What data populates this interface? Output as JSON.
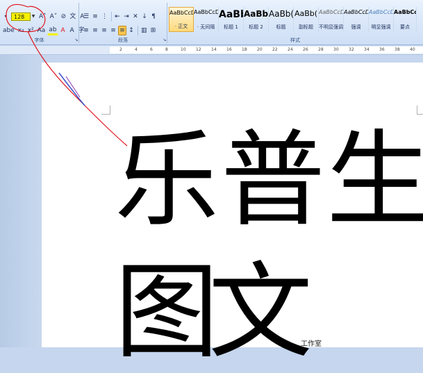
{
  "ribbon": {
    "font_size_value": "128",
    "groups": {
      "font": "字体",
      "paragraph": "段落",
      "styles": "样式"
    },
    "font_buttons_row1": [
      {
        "name": "grow-font-button",
        "glyph": "A˄"
      },
      {
        "name": "shrink-font-button",
        "glyph": "A˅"
      },
      {
        "name": "clear-format-button",
        "glyph": "⊘"
      },
      {
        "name": "phonetic-guide-button",
        "glyph": "文"
      },
      {
        "name": "char-border-button",
        "glyph": "A"
      }
    ],
    "font_buttons_row2": [
      {
        "name": "strikethrough-button",
        "glyph": "abe"
      },
      {
        "name": "subscript-button",
        "glyph": "x₂"
      },
      {
        "name": "superscript-button",
        "glyph": "x²"
      },
      {
        "name": "change-case-button",
        "glyph": "Aa"
      },
      {
        "name": "highlight-button",
        "glyph": "ab"
      },
      {
        "name": "font-color-button",
        "glyph": "A"
      },
      {
        "name": "char-shading-button",
        "glyph": "A"
      },
      {
        "name": "enclose-char-button",
        "glyph": "字"
      }
    ],
    "styles": [
      {
        "sample": "AaBbCcDd",
        "name": "· 正文",
        "size": "8px",
        "active": true,
        "width": 36
      },
      {
        "sample": "AaBbCcDd",
        "name": "· 无间隔",
        "size": "8px",
        "width": 36
      },
      {
        "sample": "AaBb",
        "name": "标题 1",
        "size": "14px",
        "bold": true,
        "width": 36
      },
      {
        "sample": "AaBb(",
        "name": "标题 2",
        "size": "12px",
        "bold": true,
        "width": 36
      },
      {
        "sample": "AaBb(",
        "name": "标题",
        "size": "12px",
        "width": 36
      },
      {
        "sample": "AaBb(",
        "name": "副标题",
        "size": "11px",
        "width": 36
      },
      {
        "sample": "AaBbCcDd",
        "name": "不明显强调",
        "size": "8px",
        "italic": true,
        "color": "#666",
        "width": 36
      },
      {
        "sample": "AaBbCcDd",
        "name": "强调",
        "size": "8px",
        "italic": true,
        "width": 36
      },
      {
        "sample": "AaBbCcDd",
        "name": "明显强调",
        "size": "8px",
        "italic": true,
        "color": "#4f81bd",
        "width": 36
      },
      {
        "sample": "AaBbCcDd",
        "name": "要点",
        "size": "8px",
        "bold": true,
        "width": 33
      }
    ]
  },
  "ruler": {
    "ticks": [
      "2",
      "4",
      "6",
      "8",
      "10",
      "12",
      "14",
      "16",
      "18",
      "20",
      "22",
      "24",
      "26",
      "28",
      "30",
      "32",
      "34",
      "36",
      "38",
      "40"
    ]
  },
  "document": {
    "line1": [
      "乐",
      "普",
      "生"
    ],
    "line2": [
      "图",
      "文"
    ],
    "watermark": "工作室"
  },
  "colors": {
    "highlight": "#f5f000",
    "annotation": "#e0141e",
    "font_color_bar": "#e0141e",
    "highlight_bar": "#f5f000"
  }
}
